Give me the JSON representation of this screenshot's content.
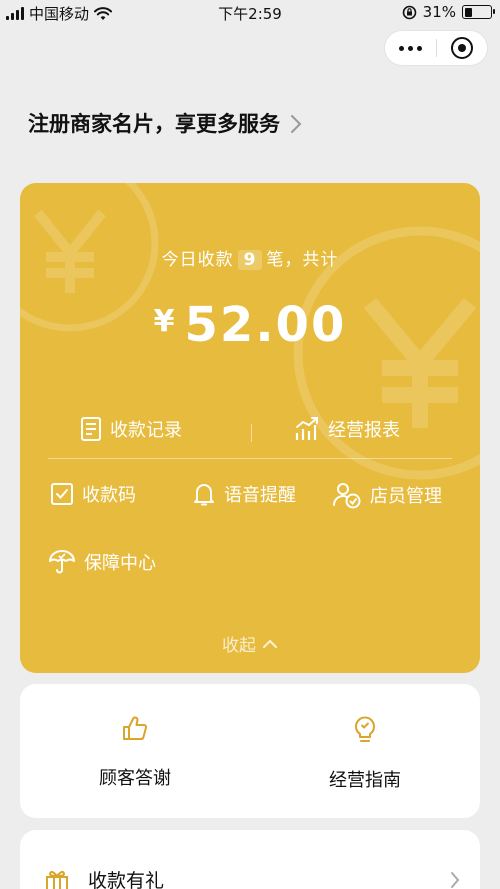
{
  "status_bar": {
    "carrier": "中国移动",
    "time": "下午2:59",
    "battery": "31%",
    "battery_level": 0.31
  },
  "register": {
    "label": "注册商家名片，享更多服务"
  },
  "income_card": {
    "today_prefix": "今日收款",
    "count": "9",
    "today_suffix": "笔，共计",
    "currency": "¥",
    "amount": "52.00",
    "records_label": "收款记录",
    "report_label": "经营报表",
    "grid": [
      {
        "label": "收款码",
        "icon": "qrcode-icon"
      },
      {
        "label": "语音提醒",
        "icon": "bell-icon"
      },
      {
        "label": "店员管理",
        "icon": "staff-icon"
      },
      {
        "label": "保障中心",
        "icon": "umbrella-icon"
      }
    ],
    "collapse_label": "收起",
    "accent": "#e7bb3e"
  },
  "services": [
    {
      "label": "顾客答谢",
      "icon": "thumbs-up-icon"
    },
    {
      "label": "经营指南",
      "icon": "lightbulb-icon"
    }
  ],
  "gift_row": {
    "label": "收款有礼",
    "icon": "gift-icon"
  },
  "colors": {
    "accent": "#e7bb3e",
    "icon_accent": "#d9a52a",
    "background": "#ededed"
  }
}
